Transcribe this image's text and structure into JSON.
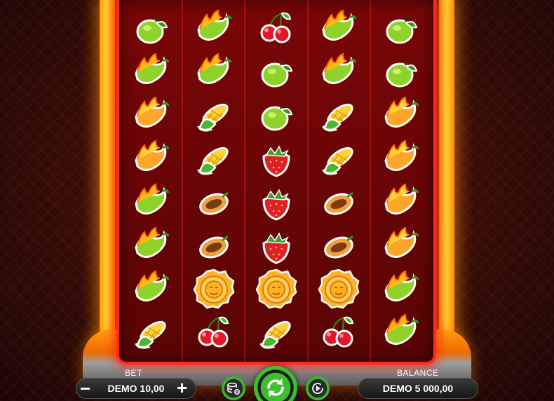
{
  "game": {
    "reels": [
      [
        "lime",
        "green-pepper",
        "orange-pepper",
        "orange-pepper",
        "green-pepper",
        "green-pepper",
        "green-pepper",
        "corn"
      ],
      [
        "green-pepper",
        "green-pepper",
        "corn",
        "corn",
        "cacao",
        "cacao",
        "aztec-coin",
        "cherry"
      ],
      [
        "cherry",
        "lime",
        "lime",
        "strawberry",
        "strawberry",
        "strawberry",
        "aztec-coin",
        "corn"
      ],
      [
        "green-pepper",
        "green-pepper",
        "corn",
        "corn",
        "cacao",
        "cacao",
        "aztec-coin",
        "cherry"
      ],
      [
        "lime",
        "lime",
        "orange-pepper",
        "orange-pepper",
        "orange-pepper",
        "orange-pepper",
        "green-pepper",
        "green-pepper"
      ]
    ]
  },
  "controls": {
    "bet_label": "BET",
    "bet_value": "DEMO 10,00",
    "balance_label": "BALANCE",
    "balance_value": "DEMO 5 000,00",
    "minus_symbol": "−",
    "plus_symbol": "+",
    "icons": {
      "minus": "minus-icon",
      "plus": "plus-icon",
      "autoplay": "coins-settings-icon",
      "spin": "refresh-arrows-icon",
      "turbo": "fast-play-icon"
    }
  },
  "colors": {
    "frame": "#ff2a1a",
    "rails": "#ffb000",
    "button_green": "#3fbf2f"
  }
}
